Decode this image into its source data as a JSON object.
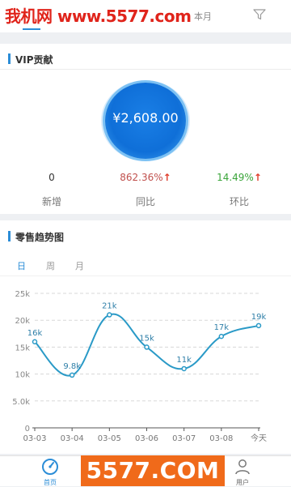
{
  "header": {
    "watermark": "我机网 www.5577.com",
    "tab_month": "本月",
    "accent_color": "#2b8dd7"
  },
  "vip": {
    "title": "VIP贡献",
    "amount": "¥2,608.00",
    "stats": [
      {
        "value": "0",
        "label": "新增",
        "color": "#333333"
      },
      {
        "value": "862.36%",
        "arrow": "↑",
        "label": "同比",
        "color": "#c0504d"
      },
      {
        "value": "14.49%",
        "arrow": "↑",
        "label": "环比",
        "color": "#3aa53a"
      }
    ]
  },
  "trend": {
    "title": "零售趋势图",
    "range_tabs": [
      "日",
      "周",
      "月"
    ],
    "active_range": "日"
  },
  "chart_data": {
    "type": "line",
    "categories": [
      "03-03",
      "03-04",
      "03-05",
      "03-06",
      "03-07",
      "03-08",
      "今天"
    ],
    "values": [
      16000,
      9800,
      21000,
      15000,
      11000,
      17000,
      19000
    ],
    "data_labels": [
      "16k",
      "9.8k",
      "21k",
      "15k",
      "11k",
      "17k",
      "19k"
    ],
    "y_ticks": [
      "0",
      "5.0k",
      "10k",
      "15k",
      "20k",
      "25k"
    ],
    "ylim": [
      0,
      25000
    ],
    "grid": true,
    "line_color": "#2a9ac7"
  },
  "bottom_nav": {
    "home_label": "首页",
    "user_label": "用户",
    "watermark": "5577.COM"
  }
}
